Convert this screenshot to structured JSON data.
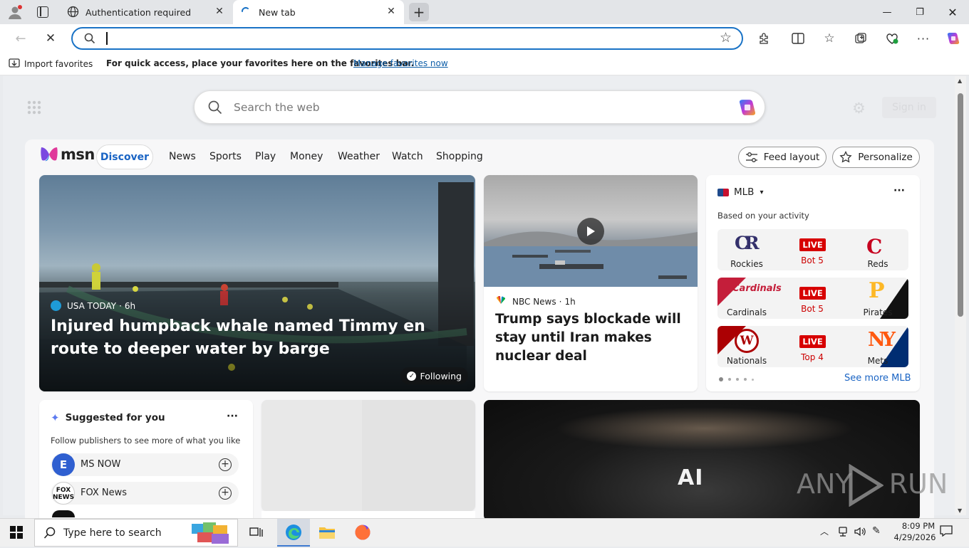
{
  "browser": {
    "tabs": [
      {
        "title": "Authentication required"
      },
      {
        "title": "New tab"
      }
    ],
    "favorites_bar": {
      "import_label": "Import favorites",
      "message": "For quick access, place your favorites here on the favorites bar.",
      "manage_link": "Manage favorites now"
    }
  },
  "newtab": {
    "search_placeholder": "Search the web",
    "sign_in": "Sign in"
  },
  "msn": {
    "logo": "msn",
    "nav": [
      "Discover",
      "News",
      "Sports",
      "Play",
      "Money",
      "Weather",
      "Watch",
      "Shopping"
    ],
    "feed_layout": "Feed layout",
    "personalize": "Personalize",
    "hero": {
      "source": "USA TODAY",
      "age": "6h",
      "headline": "Injured humpback whale named Timmy en route to deeper water by barge",
      "following": "Following"
    },
    "story2": {
      "source": "NBC News",
      "age": "1h",
      "headline": "Trump says blockade will stay until Iran makes nuclear deal"
    },
    "mlb": {
      "title": "MLB",
      "subtitle": "Based on your activity",
      "games": [
        {
          "home": "Rockies",
          "away": "Reds",
          "status": "LIVE",
          "inning": "Bot 5"
        },
        {
          "home": "Cardinals",
          "away": "Pirates",
          "status": "LIVE",
          "inning": "Bot 5"
        },
        {
          "home": "Nationals",
          "away": "Mets",
          "status": "LIVE",
          "inning": "Top 4"
        }
      ],
      "see_more": "See more MLB"
    },
    "suggested": {
      "title": "Suggested for you",
      "subtitle": "Follow publishers to see more of what you like",
      "publishers": [
        "MS NOW",
        "FOX News"
      ]
    },
    "ai_tile": "AI"
  },
  "taskbar": {
    "search_placeholder": "Type here to search",
    "time": "8:09 PM",
    "date": "4/29/2026"
  },
  "watermark": "ANY RUN"
}
